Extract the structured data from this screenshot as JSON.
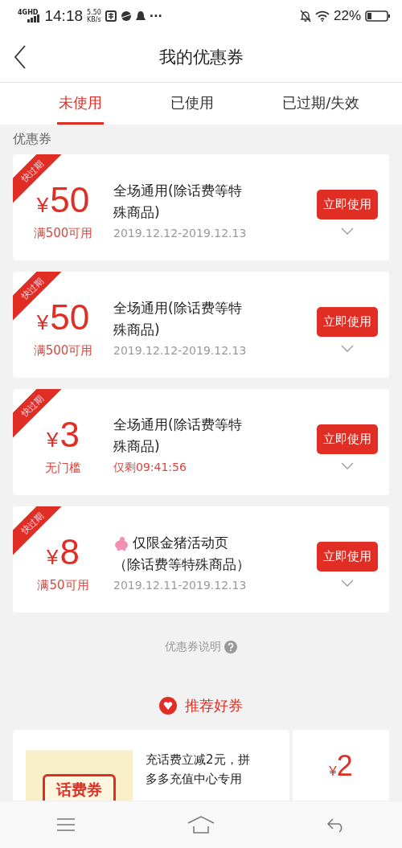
{
  "status_bar": {
    "network": "4GHD",
    "time": "14:18",
    "speed": "5.50",
    "speed_unit": "KB/s",
    "more": "···",
    "battery": "22%"
  },
  "header": {
    "title": "我的优惠券"
  },
  "tabs": [
    {
      "label": "未使用",
      "selected": true
    },
    {
      "label": "已使用",
      "selected": false
    },
    {
      "label": "已过期/失效",
      "selected": false
    }
  ],
  "section_title": "优惠券",
  "coupons": [
    {
      "kind": "standard",
      "badge": "快过期",
      "currency": "¥",
      "amount": "50",
      "condition": "满500可用",
      "title_lines": [
        "全场通用(除话费等特",
        "殊商品)"
      ],
      "validity": "2019.12.12-2019.12.13",
      "validity_urgent": false,
      "button": "立即使用",
      "expanded": false
    },
    {
      "kind": "standard",
      "badge": "快过期",
      "currency": "¥",
      "amount": "50",
      "condition": "满500可用",
      "title_lines": [
        "全场通用(除话费等特",
        "殊商品)"
      ],
      "validity": "2019.12.12-2019.12.13",
      "validity_urgent": false,
      "button": "立即使用",
      "expanded": false
    },
    {
      "kind": "standard",
      "badge": "快过期",
      "currency": "¥",
      "amount": "3",
      "condition": "无门槛",
      "title_lines": [
        "全场通用(除话费等特",
        "殊商品)"
      ],
      "validity": "仅剩09:41:56",
      "validity_urgent": true,
      "button": "立即使用",
      "expanded": false
    },
    {
      "kind": "promo",
      "badge": "快过期",
      "currency": "¥",
      "amount": "8",
      "condition": "满50可用",
      "title_lines": [
        "仅限金猪活动页",
        "（除话费等特殊商品）"
      ],
      "validity": "2019.12.11-2019.12.13",
      "validity_urgent": false,
      "button": "立即使用",
      "expanded": false
    }
  ],
  "help_link": "优惠券说明",
  "recommend": {
    "title": "推荐好券",
    "cards": [
      {
        "image_label": "话费券",
        "description": "充话费立减2元，拼多多充值中心专用",
        "currency": "¥",
        "amount": "2"
      }
    ]
  }
}
